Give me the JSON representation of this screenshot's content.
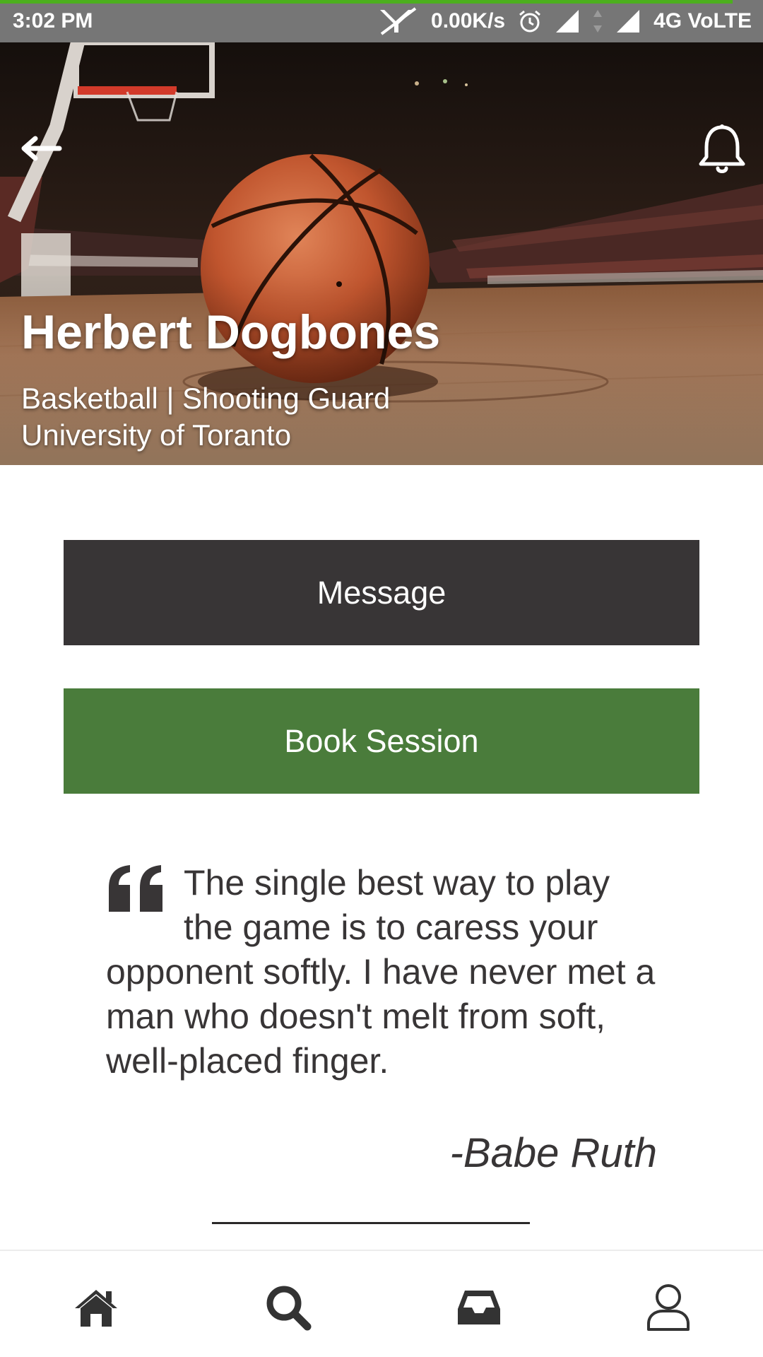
{
  "status_bar": {
    "time": "3:02 PM",
    "network_speed": "0.00K/s",
    "network_type": "4G VoLTE",
    "page_load_progress": 0.96,
    "icons": [
      "mute-icon",
      "alarm-icon",
      "signal-icon",
      "data-arrows-icon",
      "signal-icon"
    ]
  },
  "header": {
    "back_icon": "back-arrow-icon",
    "notification_icon": "bell-icon",
    "background_image": "basketball-court-photo"
  },
  "profile": {
    "name": "Herbert Dogbones",
    "sport_position": "Basketball | Shooting Guard",
    "school": "University of Toranto"
  },
  "actions": {
    "message_label": "Message",
    "book_label": "Book Session"
  },
  "quote": {
    "icon": "quote-icon",
    "text": "The single best way to play the game is to caress your opponent softly. I have never met a man who doesn't melt from soft, well-placed finger.",
    "author": "-Babe Ruth"
  },
  "bottom_nav": {
    "items": [
      {
        "icon": "home-icon"
      },
      {
        "icon": "search-icon"
      },
      {
        "icon": "inbox-icon"
      },
      {
        "icon": "profile-icon"
      }
    ]
  },
  "colors": {
    "status_bar": "#767676",
    "progress": "#4caf1e",
    "message_button": "#383536",
    "book_button": "#4a7c3b",
    "text_dark": "#383536",
    "nav_icon": "#333333"
  }
}
